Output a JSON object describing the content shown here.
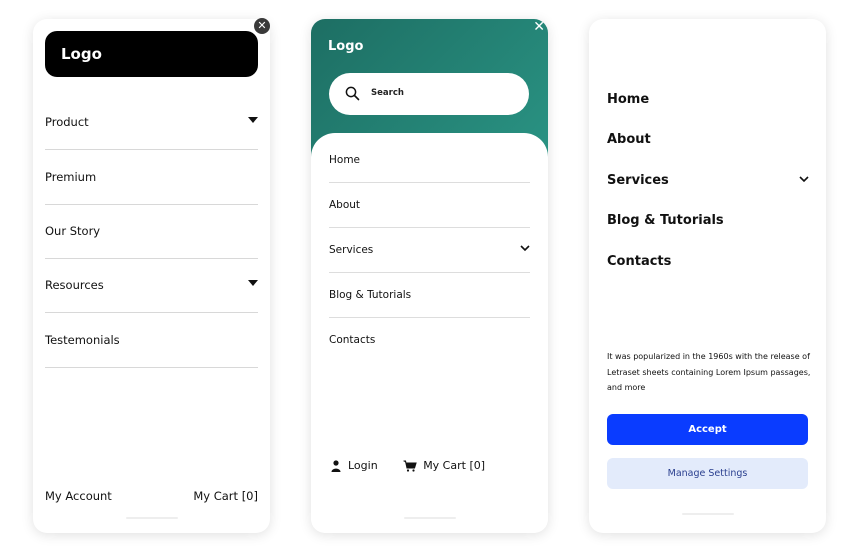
{
  "panel1": {
    "logo": "Logo",
    "menu": [
      {
        "label": "Product",
        "has_caret": true
      },
      {
        "label": "Premium",
        "has_caret": false
      },
      {
        "label": "Our Story",
        "has_caret": false
      },
      {
        "label": "Resources",
        "has_caret": true
      },
      {
        "label": "Testemonials",
        "has_caret": false
      }
    ],
    "footer": {
      "account": "My Account",
      "cart": "My Cart [0]"
    },
    "icons": {
      "close": "close-icon",
      "caret": "caret-down-icon"
    }
  },
  "panel2": {
    "logo": "Logo",
    "search_placeholder": "Search",
    "menu": [
      {
        "label": "Home"
      },
      {
        "label": "About"
      },
      {
        "label": "Services",
        "has_chevron": true
      },
      {
        "label": "Blog & Tutorials"
      },
      {
        "label": "Contacts"
      }
    ],
    "footer": {
      "login": "Login",
      "cart": "My Cart [0]"
    },
    "colors": {
      "header_start": "#1d6e63",
      "header_end": "#2a9484"
    },
    "icons": {
      "close": "close-icon",
      "search": "search-icon",
      "user": "user-icon",
      "cart": "cart-icon"
    }
  },
  "panel3": {
    "menu": [
      {
        "label": "Home"
      },
      {
        "label": "About"
      },
      {
        "label": "Services",
        "has_chevron": true
      },
      {
        "label": "Blog & Tutorials"
      },
      {
        "label": "Contacts"
      }
    ],
    "notice": "It was popularized in the 1960s with the release of Letraset sheets containing Lorem Ipsum passages, and more",
    "accept": "Accept",
    "manage": "Manage Settings",
    "colors": {
      "accept_bg": "#0a3cff",
      "manage_bg": "#e3ebfb"
    }
  }
}
